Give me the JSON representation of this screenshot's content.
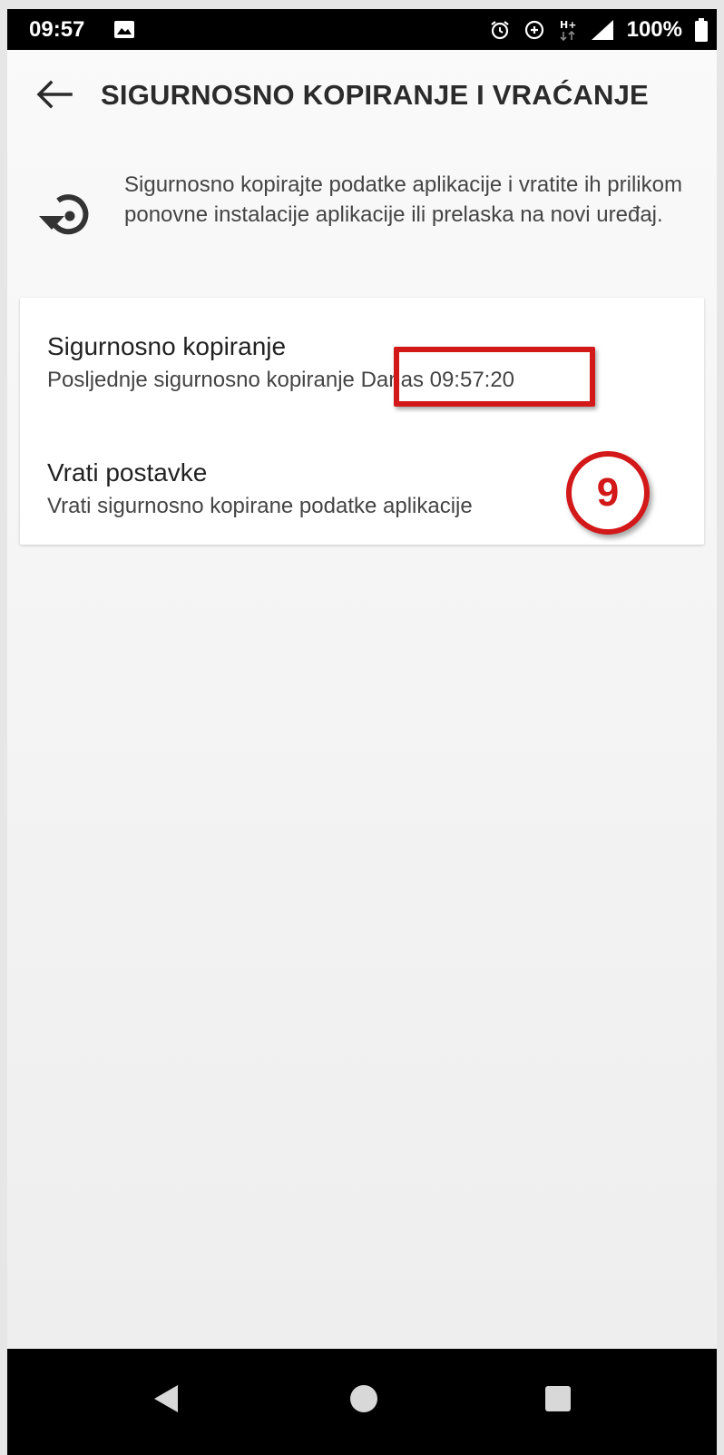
{
  "status_bar": {
    "time": "09:57",
    "battery": "100%",
    "icons": [
      "photo-icon",
      "alarm-icon",
      "data-saver-icon",
      "network-hplus-icon",
      "signal-icon",
      "battery-icon"
    ]
  },
  "toolbar": {
    "title": "SIGURNOSNO KOPIRANJE I VRAĆANJE",
    "back_icon": "arrow-back-icon"
  },
  "intro": {
    "icon": "restore-icon",
    "text": "Sigurnosno kopirajte podatke aplikacije i vratite ih prilikom ponovne instalacije aplikacije ili prelaska na novi uređaj."
  },
  "card": {
    "items": [
      {
        "title": "Sigurnosno kopiranje",
        "subtitle_prefix": "Posljednje sigurnosno kopiranje",
        "subtitle_value": "Danas 09:57:20"
      },
      {
        "title": "Vrati postavke",
        "subtitle": "Vrati sigurnosno kopirane podatke aplikacije"
      }
    ]
  },
  "annotation": {
    "step_number": "9",
    "color": "#d21818"
  },
  "nav_bar": {
    "buttons": [
      "nav-back-icon",
      "nav-home-icon",
      "nav-recents-icon"
    ]
  }
}
